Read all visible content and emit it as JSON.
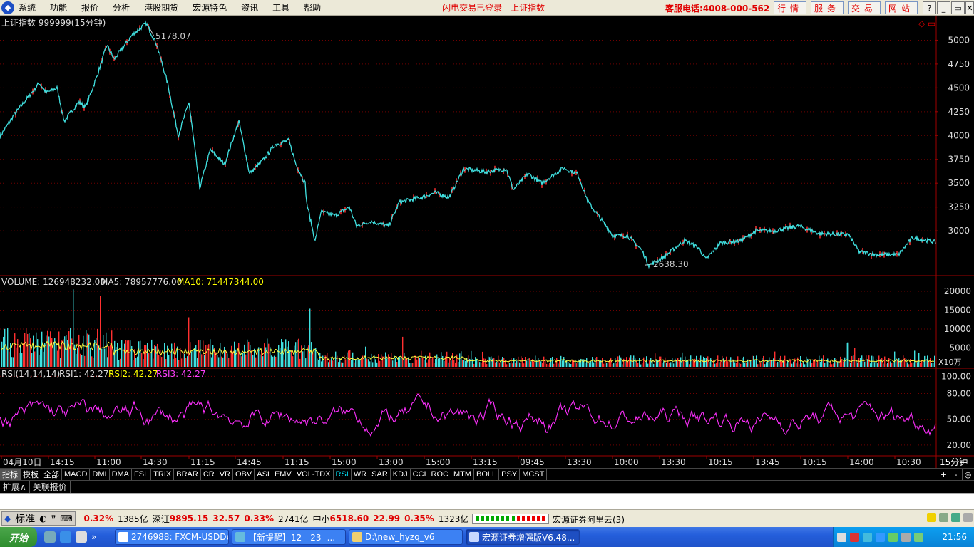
{
  "menubar": {
    "items": [
      "系统",
      "功能",
      "报价",
      "分析",
      "港股期货",
      "宏源特色",
      "资讯",
      "工具",
      "帮助"
    ],
    "status1": "闪电交易已登录",
    "status2": "上证指数",
    "hotline": "客服电话:4008-000-562",
    "buttons": [
      "行情",
      "服务",
      "交易",
      "网站"
    ],
    "window_controls": [
      "?",
      "_",
      "▭",
      "✕"
    ]
  },
  "chart_data": [
    {
      "type": "line",
      "title": "上证指数 999999(15分钟)",
      "y_ticks": [
        5000,
        4750,
        4500,
        4250,
        4000,
        3750,
        3500,
        3250,
        3000
      ],
      "ylim": [
        2560,
        5220
      ],
      "high_label": "5178.07",
      "low_label": "2638.30",
      "anchors": [
        [
          0,
          3990
        ],
        [
          20,
          4220
        ],
        [
          55,
          4550
        ],
        [
          65,
          4450
        ],
        [
          80,
          4500
        ],
        [
          90,
          4150
        ],
        [
          110,
          4350
        ],
        [
          120,
          4300
        ],
        [
          135,
          4600
        ],
        [
          150,
          4950
        ],
        [
          160,
          4800
        ],
        [
          185,
          5050
        ],
        [
          205,
          5178
        ],
        [
          220,
          4950
        ],
        [
          235,
          4550
        ],
        [
          250,
          4000
        ],
        [
          265,
          4350
        ],
        [
          280,
          3450
        ],
        [
          295,
          3850
        ],
        [
          315,
          3700
        ],
        [
          335,
          4150
        ],
        [
          350,
          3600
        ],
        [
          370,
          3750
        ],
        [
          385,
          3900
        ],
        [
          405,
          3950
        ],
        [
          415,
          3700
        ],
        [
          428,
          3500
        ],
        [
          430,
          3300
        ],
        [
          442,
          2890
        ],
        [
          450,
          3200
        ],
        [
          470,
          3160
        ],
        [
          490,
          3250
        ],
        [
          500,
          3050
        ],
        [
          520,
          3100
        ],
        [
          545,
          3050
        ],
        [
          560,
          3300
        ],
        [
          590,
          3350
        ],
        [
          610,
          3400
        ],
        [
          630,
          3350
        ],
        [
          650,
          3650
        ],
        [
          680,
          3620
        ],
        [
          710,
          3650
        ],
        [
          720,
          3430
        ],
        [
          740,
          3600
        ],
        [
          760,
          3500
        ],
        [
          790,
          3660
        ],
        [
          810,
          3600
        ],
        [
          825,
          3300
        ],
        [
          840,
          3150
        ],
        [
          860,
          2950
        ],
        [
          880,
          2950
        ],
        [
          900,
          2800
        ],
        [
          910,
          2640
        ],
        [
          930,
          2720
        ],
        [
          960,
          2900
        ],
        [
          980,
          2820
        ],
        [
          990,
          2700
        ],
        [
          1010,
          2870
        ],
        [
          1040,
          2900
        ],
        [
          1060,
          3000
        ],
        [
          1085,
          3000
        ],
        [
          1120,
          3050
        ],
        [
          1150,
          2970
        ],
        [
          1190,
          2960
        ],
        [
          1205,
          2780
        ],
        [
          1230,
          2750
        ],
        [
          1260,
          2750
        ],
        [
          1280,
          2930
        ],
        [
          1300,
          2900
        ],
        [
          1312,
          2880
        ]
      ],
      "x_labels": [
        {
          "t": "04月10日",
          "x": 2
        },
        {
          "t": "14:15",
          "x": 68
        },
        {
          "t": "11:00",
          "x": 133
        },
        {
          "t": "14:30",
          "x": 198
        },
        {
          "t": "11:15",
          "x": 265
        },
        {
          "t": "14:45",
          "x": 330
        },
        {
          "t": "11:15",
          "x": 397
        },
        {
          "t": "15:00",
          "x": 463
        },
        {
          "t": "13:00",
          "x": 529
        },
        {
          "t": "15:00",
          "x": 595
        },
        {
          "t": "13:15",
          "x": 661
        },
        {
          "t": "09:45",
          "x": 727
        },
        {
          "t": "13:30",
          "x": 793
        },
        {
          "t": "10:00",
          "x": 859
        },
        {
          "t": "13:30",
          "x": 925
        },
        {
          "t": "10:15",
          "x": 991
        },
        {
          "t": "13:45",
          "x": 1057
        },
        {
          "t": "10:15",
          "x": 1123
        },
        {
          "t": "14:00",
          "x": 1189
        },
        {
          "t": "10:30",
          "x": 1255
        }
      ],
      "period": "15分钟"
    },
    {
      "type": "bar",
      "header": "VOLUME: 126948232.00",
      "ma5": "MA5: 78957776.00",
      "ma10": "MA10: 71447344.00",
      "y_ticks": [
        20000,
        15000,
        10000,
        5000
      ],
      "ylim": [
        0,
        21500
      ],
      "unit": "X10万"
    },
    {
      "type": "line",
      "header": "RSI(14,14,14)",
      "rsi1": "RSI1: 42.27",
      "rsi2": "RSI2: 42.27",
      "rsi3": "RSI3: 42.27",
      "y_ticks": [
        "100.00",
        "80.00",
        "50.00",
        "20.00"
      ],
      "ylim": [
        10,
        102
      ]
    }
  ],
  "indicator_tabs": [
    "指标",
    "模板",
    "全部",
    "MACD",
    "DMI",
    "DMA",
    "FSL",
    "TRIX",
    "BRAR",
    "CR",
    "VR",
    "OBV",
    "ASI",
    "EMV",
    "VOL-TDX",
    "RSI",
    "WR",
    "SAR",
    "KDJ",
    "CCI",
    "ROC",
    "MTM",
    "BOLL",
    "PSY",
    "MCST"
  ],
  "active_indicator": "RSI",
  "zoom_controls": [
    "+",
    "-",
    "◎"
  ],
  "ext_tabs": [
    "扩展∧",
    "关联报价"
  ],
  "statusbar": {
    "std_label": "标准",
    "sh_pct": "0.32%",
    "sh_amt": "1385亿",
    "sz_name": "深证",
    "sz_val": "9895.15",
    "sz_chg": "32.57",
    "sz_pct": "0.33%",
    "sz_amt": "2741亿",
    "zx_name": "中小",
    "zx_val": "6518.60",
    "zx_chg": "22.99",
    "zx_pct": "0.35%",
    "zx_amt": "1323亿",
    "server": "宏源证券阿里云(3)"
  },
  "taskbar": {
    "start": "开始",
    "tasks": [
      "2746988: FXCM-USDDe...",
      "【新提醒】12 - 23 -...",
      "D:\\new_hyzq_v6",
      "宏源证券增强版V6.48..."
    ],
    "clock": "21:56"
  }
}
